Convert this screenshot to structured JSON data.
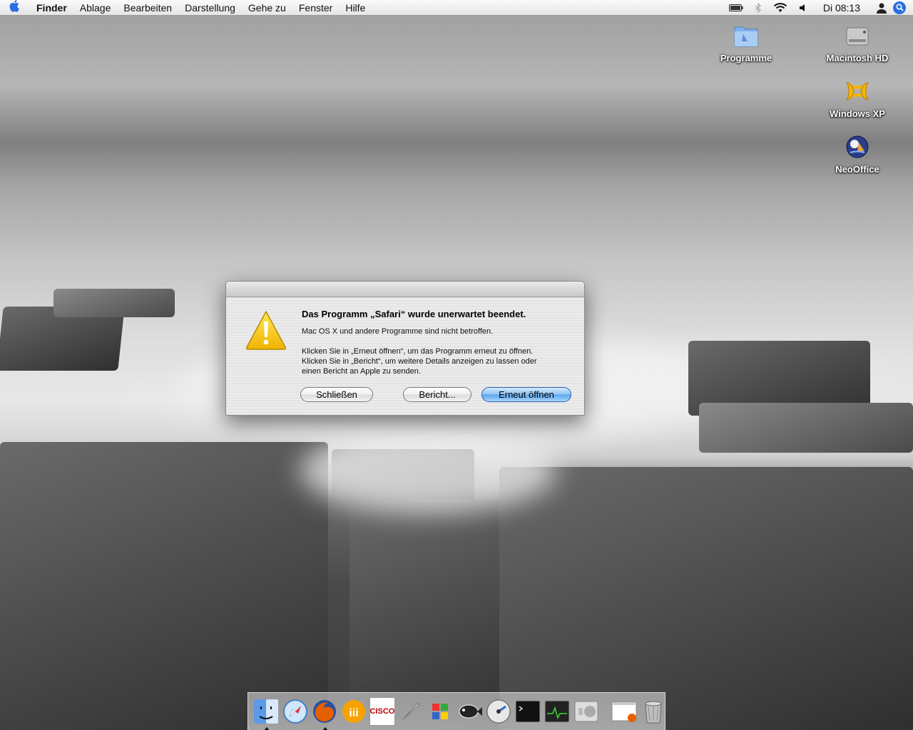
{
  "menubar": {
    "app_name": "Finder",
    "items": [
      "Ablage",
      "Bearbeiten",
      "Darstellung",
      "Gehe zu",
      "Fenster",
      "Hilfe"
    ],
    "clock": "Di 08:13"
  },
  "desktop_icons": {
    "programme": "Programme",
    "macintosh_hd": "Macintosh HD",
    "windows_xp": "Windows XP",
    "neooffice": "NeoOffice"
  },
  "dialog": {
    "title": "Das Programm „Safari“ wurde unerwartet beendet.",
    "line1": "Mac OS X und andere Programme sind nicht betroffen.",
    "line2": "Klicken Sie in „Erneut öffnen“, um das Programm erneut zu öffnen.",
    "line3": "Klicken Sie in „Bericht“, um weitere Details anzeigen zu lassen oder",
    "line4": "einen Bericht an Apple zu senden.",
    "close_label": "Schließen",
    "report_label": "Bericht...",
    "reopen_label": "Erneut öffnen"
  },
  "dock": {
    "cisco_text": "CISCO"
  },
  "colors": {
    "accent": "#2a6fe0",
    "alert_yellow": "#f5c400",
    "default_button": "#5aa5ea"
  }
}
